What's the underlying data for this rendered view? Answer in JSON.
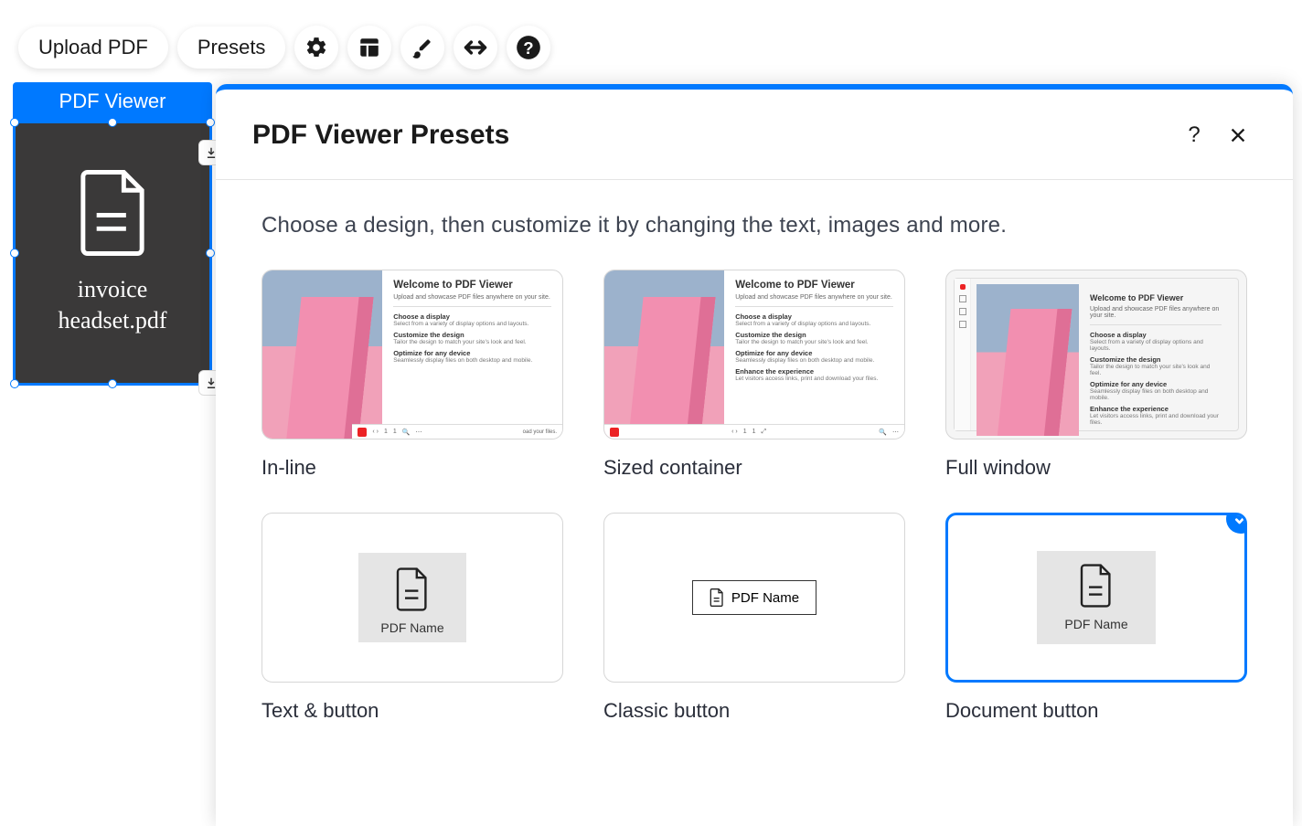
{
  "toolbar": {
    "upload_label": "Upload PDF",
    "presets_label": "Presets"
  },
  "widget": {
    "header": "PDF Viewer",
    "filename_line1": "invoice",
    "filename_line2": "headset.pdf"
  },
  "panel": {
    "title": "PDF Viewer Presets",
    "intro": "Choose a design, then customize it by changing the text, images and more."
  },
  "presets": [
    {
      "label": "In-line"
    },
    {
      "label": "Sized container"
    },
    {
      "label": "Full window"
    },
    {
      "label": "Text & button"
    },
    {
      "label": "Classic button"
    },
    {
      "label": "Document button"
    }
  ],
  "thumb": {
    "title": "Welcome to PDF Viewer",
    "subtitle": "Upload and showcase PDF files anywhere on your site.",
    "sec1": "Choose a display",
    "desc1": "Select from a variety of display options and layouts.",
    "sec2": "Customize the design",
    "desc2": "Tailor the design to match your site's look and feel.",
    "sec3": "Optimize for any device",
    "desc3": "Seamlessly display files on both desktop and mobile.",
    "sec4": "Enhance the experience",
    "desc4": "Let visitors access links, print and download your files.",
    "pdf_name": "PDF Name",
    "page": "1"
  },
  "selected_preset_index": 5
}
